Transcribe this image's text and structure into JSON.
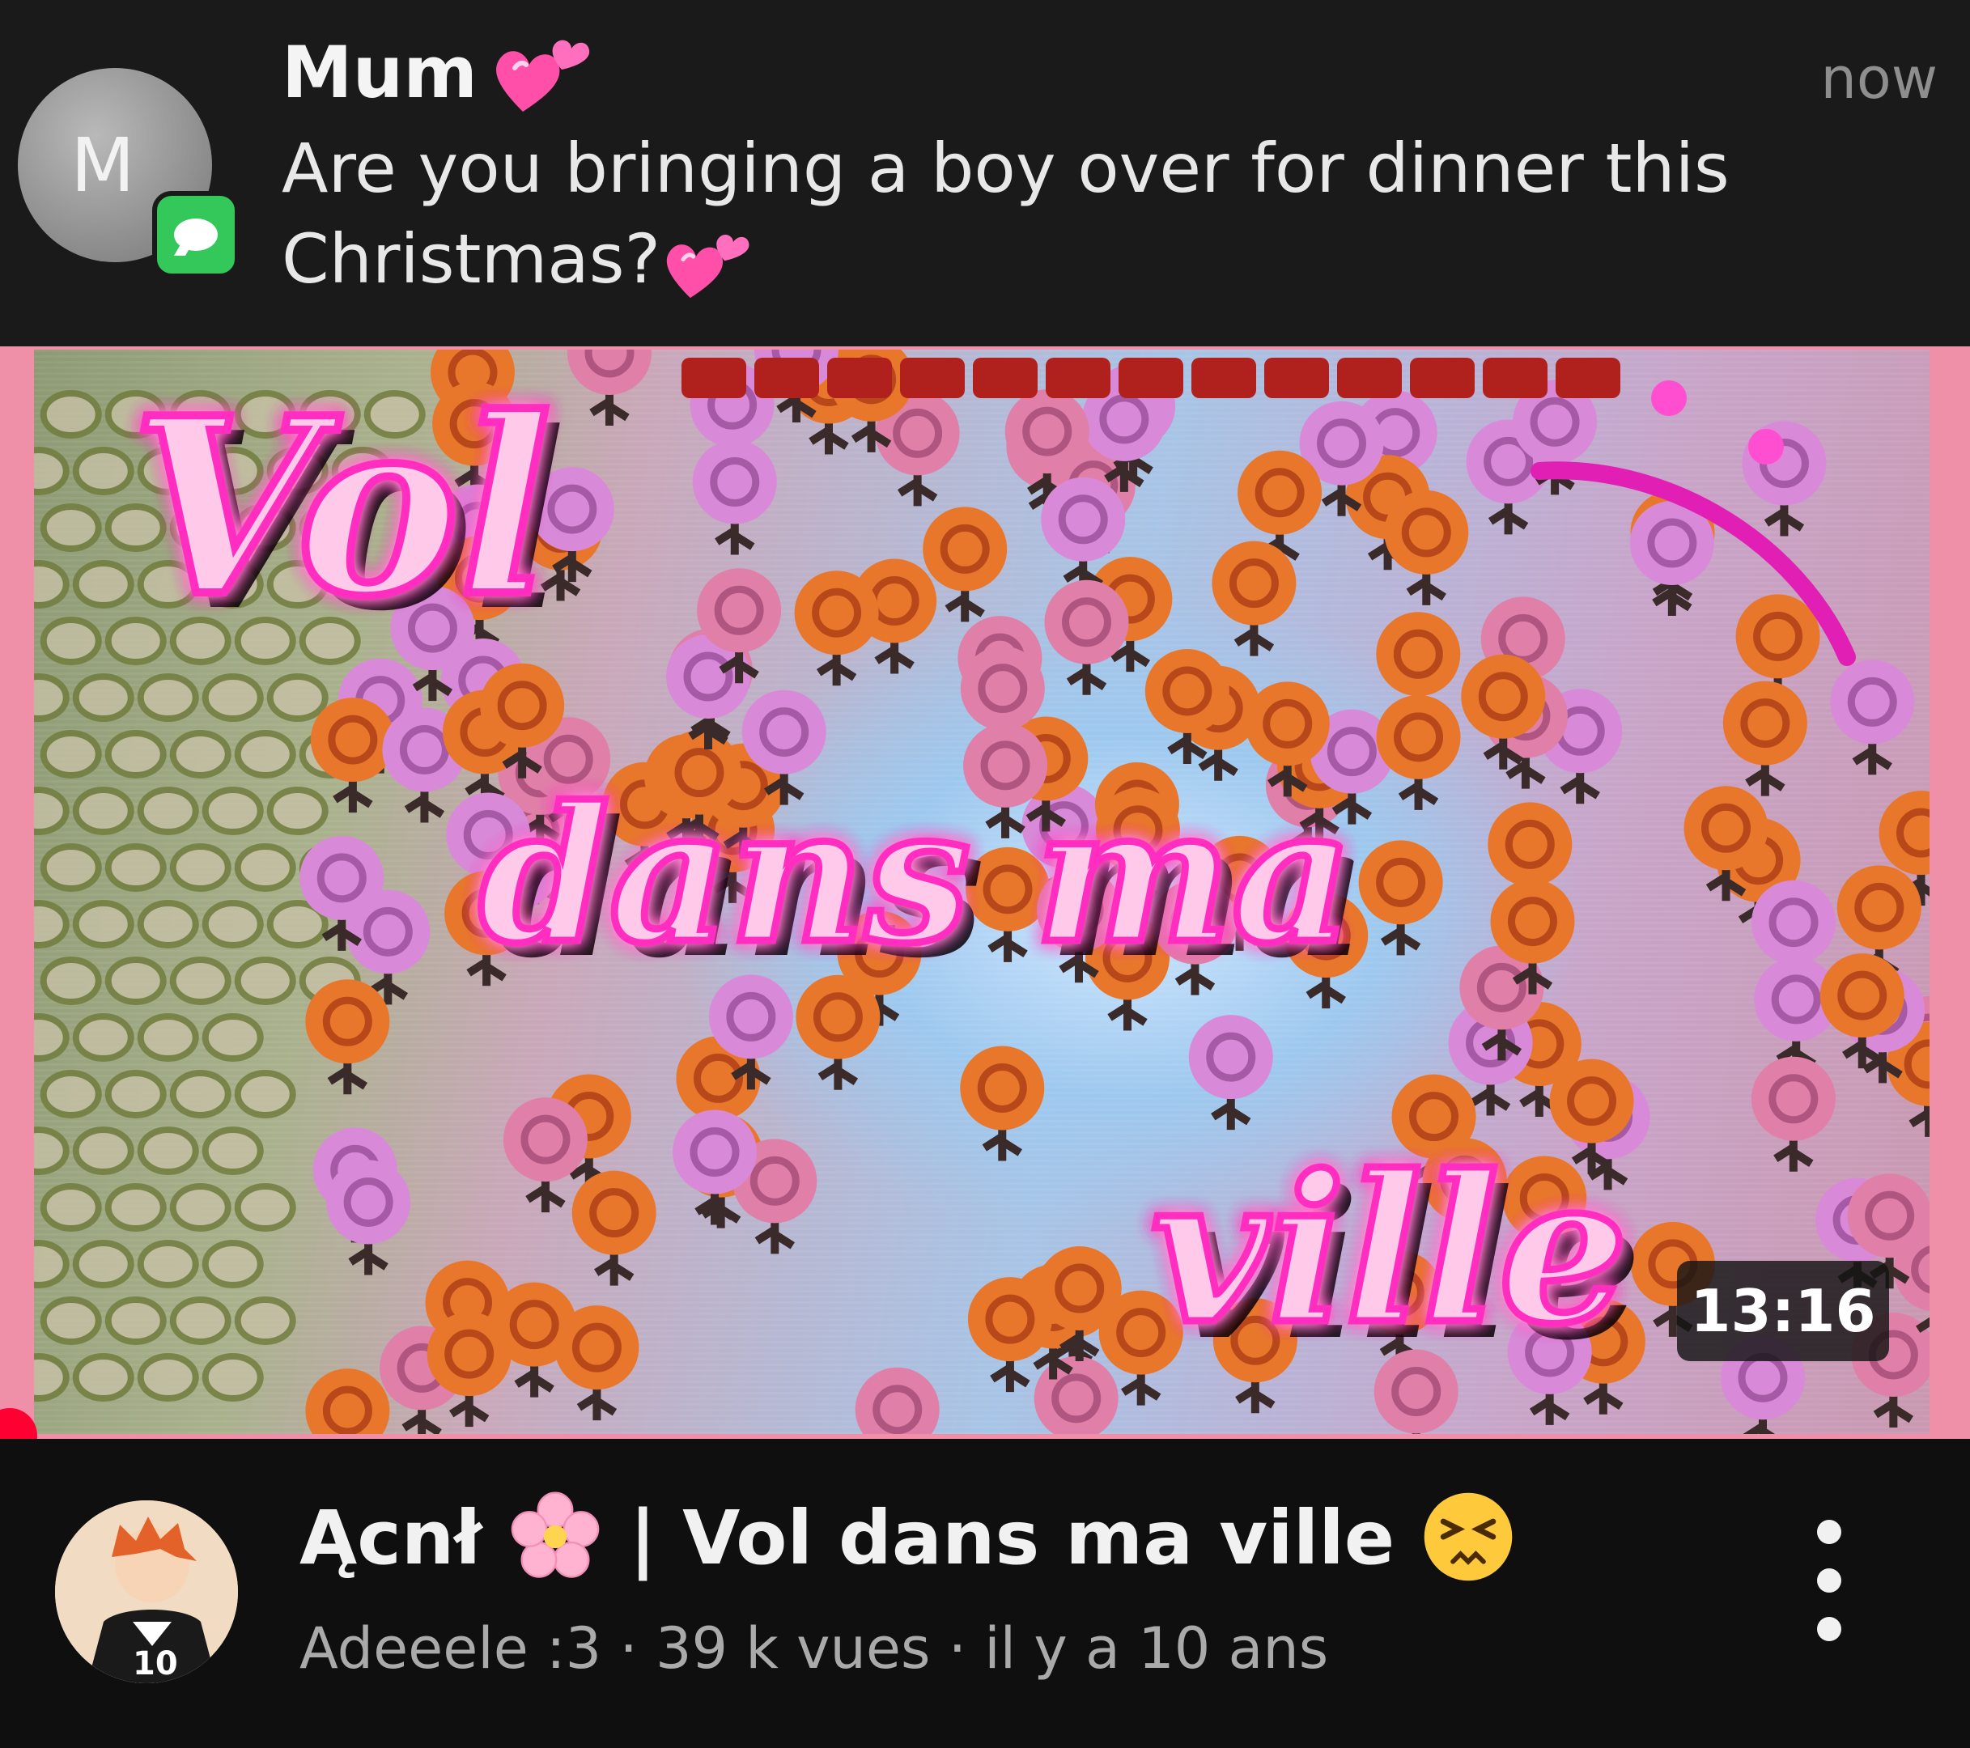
{
  "notification": {
    "sender": "Mum",
    "sender_emoji": "two-hearts",
    "time": "now",
    "avatar_letter": "M",
    "app_icon": "messages-icon",
    "body_line1": "Are you bringing a boy over for dinner this",
    "body_line2": "Christmas?",
    "body_emoji": "two-hearts"
  },
  "video": {
    "thumbnail_title_lines": [
      "Vol",
      "dans ma",
      "ville"
    ],
    "duration": "13:16",
    "title_part1": "Ącnł",
    "title_part2": "| Vol dans ma ville",
    "title_emoji_1": "cherry-blossom",
    "title_emoji_2": "persevering-face",
    "channel": "Adeeele :3",
    "views": "39 k vues",
    "age": "il y a 10 ans",
    "separator": "·"
  },
  "colors": {
    "notification_bg": "#1a1a1a",
    "page_bg": "#0f0f0f",
    "thumb_frame": "#ef8fa8",
    "progress": "#ff0033",
    "title_pink": "#ffc9ea",
    "title_glow": "#ff2fc0"
  }
}
